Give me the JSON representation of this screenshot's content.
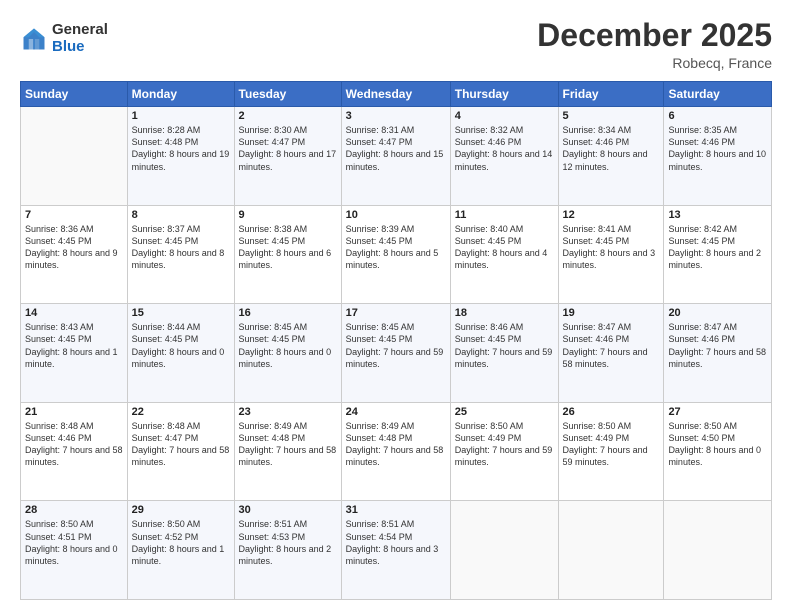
{
  "header": {
    "logo_general": "General",
    "logo_blue": "Blue",
    "month_title": "December 2025",
    "location": "Robecq, France"
  },
  "weekdays": [
    "Sunday",
    "Monday",
    "Tuesday",
    "Wednesday",
    "Thursday",
    "Friday",
    "Saturday"
  ],
  "weeks": [
    [
      {
        "day": "",
        "sunrise": "",
        "sunset": "",
        "daylight": ""
      },
      {
        "day": "1",
        "sunrise": "Sunrise: 8:28 AM",
        "sunset": "Sunset: 4:48 PM",
        "daylight": "Daylight: 8 hours and 19 minutes."
      },
      {
        "day": "2",
        "sunrise": "Sunrise: 8:30 AM",
        "sunset": "Sunset: 4:47 PM",
        "daylight": "Daylight: 8 hours and 17 minutes."
      },
      {
        "day": "3",
        "sunrise": "Sunrise: 8:31 AM",
        "sunset": "Sunset: 4:47 PM",
        "daylight": "Daylight: 8 hours and 15 minutes."
      },
      {
        "day": "4",
        "sunrise": "Sunrise: 8:32 AM",
        "sunset": "Sunset: 4:46 PM",
        "daylight": "Daylight: 8 hours and 14 minutes."
      },
      {
        "day": "5",
        "sunrise": "Sunrise: 8:34 AM",
        "sunset": "Sunset: 4:46 PM",
        "daylight": "Daylight: 8 hours and 12 minutes."
      },
      {
        "day": "6",
        "sunrise": "Sunrise: 8:35 AM",
        "sunset": "Sunset: 4:46 PM",
        "daylight": "Daylight: 8 hours and 10 minutes."
      }
    ],
    [
      {
        "day": "7",
        "sunrise": "Sunrise: 8:36 AM",
        "sunset": "Sunset: 4:45 PM",
        "daylight": "Daylight: 8 hours and 9 minutes."
      },
      {
        "day": "8",
        "sunrise": "Sunrise: 8:37 AM",
        "sunset": "Sunset: 4:45 PM",
        "daylight": "Daylight: 8 hours and 8 minutes."
      },
      {
        "day": "9",
        "sunrise": "Sunrise: 8:38 AM",
        "sunset": "Sunset: 4:45 PM",
        "daylight": "Daylight: 8 hours and 6 minutes."
      },
      {
        "day": "10",
        "sunrise": "Sunrise: 8:39 AM",
        "sunset": "Sunset: 4:45 PM",
        "daylight": "Daylight: 8 hours and 5 minutes."
      },
      {
        "day": "11",
        "sunrise": "Sunrise: 8:40 AM",
        "sunset": "Sunset: 4:45 PM",
        "daylight": "Daylight: 8 hours and 4 minutes."
      },
      {
        "day": "12",
        "sunrise": "Sunrise: 8:41 AM",
        "sunset": "Sunset: 4:45 PM",
        "daylight": "Daylight: 8 hours and 3 minutes."
      },
      {
        "day": "13",
        "sunrise": "Sunrise: 8:42 AM",
        "sunset": "Sunset: 4:45 PM",
        "daylight": "Daylight: 8 hours and 2 minutes."
      }
    ],
    [
      {
        "day": "14",
        "sunrise": "Sunrise: 8:43 AM",
        "sunset": "Sunset: 4:45 PM",
        "daylight": "Daylight: 8 hours and 1 minute."
      },
      {
        "day": "15",
        "sunrise": "Sunrise: 8:44 AM",
        "sunset": "Sunset: 4:45 PM",
        "daylight": "Daylight: 8 hours and 0 minutes."
      },
      {
        "day": "16",
        "sunrise": "Sunrise: 8:45 AM",
        "sunset": "Sunset: 4:45 PM",
        "daylight": "Daylight: 8 hours and 0 minutes."
      },
      {
        "day": "17",
        "sunrise": "Sunrise: 8:45 AM",
        "sunset": "Sunset: 4:45 PM",
        "daylight": "Daylight: 7 hours and 59 minutes."
      },
      {
        "day": "18",
        "sunrise": "Sunrise: 8:46 AM",
        "sunset": "Sunset: 4:45 PM",
        "daylight": "Daylight: 7 hours and 59 minutes."
      },
      {
        "day": "19",
        "sunrise": "Sunrise: 8:47 AM",
        "sunset": "Sunset: 4:46 PM",
        "daylight": "Daylight: 7 hours and 58 minutes."
      },
      {
        "day": "20",
        "sunrise": "Sunrise: 8:47 AM",
        "sunset": "Sunset: 4:46 PM",
        "daylight": "Daylight: 7 hours and 58 minutes."
      }
    ],
    [
      {
        "day": "21",
        "sunrise": "Sunrise: 8:48 AM",
        "sunset": "Sunset: 4:46 PM",
        "daylight": "Daylight: 7 hours and 58 minutes."
      },
      {
        "day": "22",
        "sunrise": "Sunrise: 8:48 AM",
        "sunset": "Sunset: 4:47 PM",
        "daylight": "Daylight: 7 hours and 58 minutes."
      },
      {
        "day": "23",
        "sunrise": "Sunrise: 8:49 AM",
        "sunset": "Sunset: 4:48 PM",
        "daylight": "Daylight: 7 hours and 58 minutes."
      },
      {
        "day": "24",
        "sunrise": "Sunrise: 8:49 AM",
        "sunset": "Sunset: 4:48 PM",
        "daylight": "Daylight: 7 hours and 58 minutes."
      },
      {
        "day": "25",
        "sunrise": "Sunrise: 8:50 AM",
        "sunset": "Sunset: 4:49 PM",
        "daylight": "Daylight: 7 hours and 59 minutes."
      },
      {
        "day": "26",
        "sunrise": "Sunrise: 8:50 AM",
        "sunset": "Sunset: 4:49 PM",
        "daylight": "Daylight: 7 hours and 59 minutes."
      },
      {
        "day": "27",
        "sunrise": "Sunrise: 8:50 AM",
        "sunset": "Sunset: 4:50 PM",
        "daylight": "Daylight: 8 hours and 0 minutes."
      }
    ],
    [
      {
        "day": "28",
        "sunrise": "Sunrise: 8:50 AM",
        "sunset": "Sunset: 4:51 PM",
        "daylight": "Daylight: 8 hours and 0 minutes."
      },
      {
        "day": "29",
        "sunrise": "Sunrise: 8:50 AM",
        "sunset": "Sunset: 4:52 PM",
        "daylight": "Daylight: 8 hours and 1 minute."
      },
      {
        "day": "30",
        "sunrise": "Sunrise: 8:51 AM",
        "sunset": "Sunset: 4:53 PM",
        "daylight": "Daylight: 8 hours and 2 minutes."
      },
      {
        "day": "31",
        "sunrise": "Sunrise: 8:51 AM",
        "sunset": "Sunset: 4:54 PM",
        "daylight": "Daylight: 8 hours and 3 minutes."
      },
      {
        "day": "",
        "sunrise": "",
        "sunset": "",
        "daylight": ""
      },
      {
        "day": "",
        "sunrise": "",
        "sunset": "",
        "daylight": ""
      },
      {
        "day": "",
        "sunrise": "",
        "sunset": "",
        "daylight": ""
      }
    ]
  ]
}
